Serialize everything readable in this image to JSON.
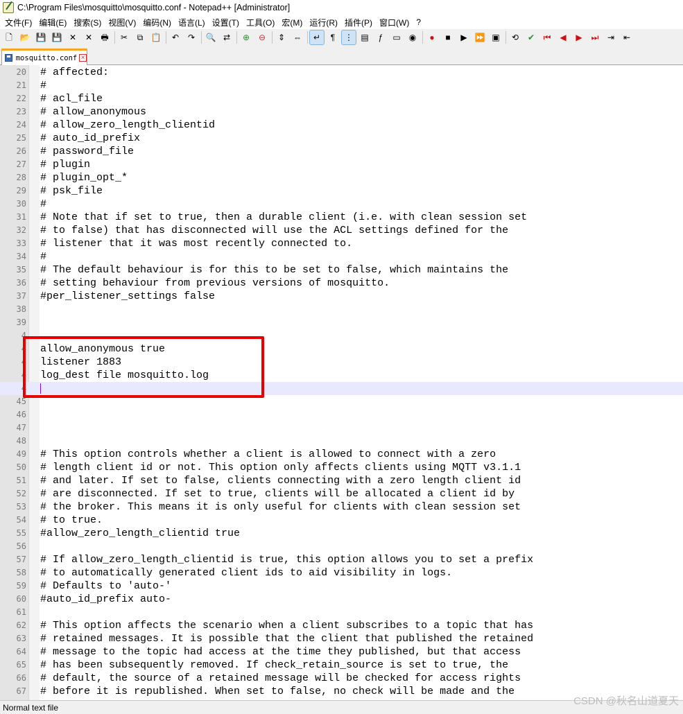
{
  "window": {
    "title": "C:\\Program Files\\mosquitto\\mosquitto.conf - Notepad++ [Administrator]"
  },
  "menu": [
    "文件(F)",
    "编辑(E)",
    "搜索(S)",
    "视图(V)",
    "编码(N)",
    "语言(L)",
    "设置(T)",
    "工具(O)",
    "宏(M)",
    "运行(R)",
    "插件(P)",
    "窗口(W)",
    "?"
  ],
  "toolbar": {
    "icons": [
      "new-icon",
      "open-icon",
      "save-icon",
      "save-all-icon",
      "close-icon",
      "close-all-icon",
      "print-icon",
      "cut-icon",
      "copy-icon",
      "paste-icon",
      "undo-icon",
      "redo-icon",
      "find-icon",
      "replace-icon",
      "zoom-in-icon",
      "zoom-out-icon",
      "sync-vertical-icon",
      "sync-horizontal-icon",
      "word-wrap-icon",
      "show-all-chars-icon",
      "indent-guide-icon",
      "doc-map-icon",
      "function-list-icon",
      "folder-workspace-icon",
      "monitor-icon",
      "record-macro-icon",
      "stop-macro-icon",
      "play-macro-icon",
      "run-macro-multiple-icon",
      "save-macro-icon",
      "plugin-a-icon",
      "plugin-b-icon",
      "nav-first-icon",
      "nav-prev-icon",
      "nav-next-icon",
      "nav-last-icon",
      "plugin-c-icon",
      "plugin-d-icon"
    ],
    "active": [
      "word-wrap-icon",
      "indent-guide-icon"
    ]
  },
  "tab": {
    "label": "mosquitto.conf"
  },
  "editor": {
    "current_line": 44,
    "lines": [
      {
        "n": "20",
        "text": "# affected:"
      },
      {
        "n": "21",
        "text": "#"
      },
      {
        "n": "22",
        "text": "# acl_file"
      },
      {
        "n": "23",
        "text": "# allow_anonymous"
      },
      {
        "n": "24",
        "text": "# allow_zero_length_clientid"
      },
      {
        "n": "25",
        "text": "# auto_id_prefix"
      },
      {
        "n": "26",
        "text": "# password_file"
      },
      {
        "n": "27",
        "text": "# plugin"
      },
      {
        "n": "28",
        "text": "# plugin_opt_*"
      },
      {
        "n": "29",
        "text": "# psk_file"
      },
      {
        "n": "30",
        "text": "#"
      },
      {
        "n": "31",
        "text": "# Note that if set to true, then a durable client (i.e. with clean session set"
      },
      {
        "n": "32",
        "text": "# to false) that has disconnected will use the ACL settings defined for the"
      },
      {
        "n": "33",
        "text": "# listener that it was most recently connected to."
      },
      {
        "n": "34",
        "text": "#"
      },
      {
        "n": "35",
        "text": "# The default behaviour is for this to be set to false, which maintains the"
      },
      {
        "n": "36",
        "text": "# setting behaviour from previous versions of mosquitto."
      },
      {
        "n": "37",
        "text": "#per_listener_settings false"
      },
      {
        "n": "38",
        "text": ""
      },
      {
        "n": "39",
        "text": ""
      },
      {
        "n": "4",
        "text": ""
      },
      {
        "n": "4",
        "text": "allow_anonymous true"
      },
      {
        "n": "4",
        "text": "listener 1883"
      },
      {
        "n": "4",
        "text": "log_dest file mosquitto.log"
      },
      {
        "n": "4",
        "text": ""
      },
      {
        "n": "45",
        "text": ""
      },
      {
        "n": "46",
        "text": ""
      },
      {
        "n": "47",
        "text": ""
      },
      {
        "n": "48",
        "text": ""
      },
      {
        "n": "49",
        "text": "# This option controls whether a client is allowed to connect with a zero"
      },
      {
        "n": "50",
        "text": "# length client id or not. This option only affects clients using MQTT v3.1.1"
      },
      {
        "n": "51",
        "text": "# and later. If set to false, clients connecting with a zero length client id"
      },
      {
        "n": "52",
        "text": "# are disconnected. If set to true, clients will be allocated a client id by"
      },
      {
        "n": "53",
        "text": "# the broker. This means it is only useful for clients with clean session set"
      },
      {
        "n": "54",
        "text": "# to true."
      },
      {
        "n": "55",
        "text": "#allow_zero_length_clientid true"
      },
      {
        "n": "56",
        "text": ""
      },
      {
        "n": "57",
        "text": "# If allow_zero_length_clientid is true, this option allows you to set a prefix"
      },
      {
        "n": "58",
        "text": "# to automatically generated client ids to aid visibility in logs."
      },
      {
        "n": "59",
        "text": "# Defaults to 'auto-'"
      },
      {
        "n": "60",
        "text": "#auto_id_prefix auto-"
      },
      {
        "n": "61",
        "text": ""
      },
      {
        "n": "62",
        "text": "# This option affects the scenario when a client subscribes to a topic that has"
      },
      {
        "n": "63",
        "text": "# retained messages. It is possible that the client that published the retained"
      },
      {
        "n": "64",
        "text": "# message to the topic had access at the time they published, but that access"
      },
      {
        "n": "65",
        "text": "# has been subsequently removed. If check_retain_source is set to true, the"
      },
      {
        "n": "66",
        "text": "# default, the source of a retained message will be checked for access rights"
      },
      {
        "n": "67",
        "text": "# before it is republished. When set to false, no check will be made and the"
      }
    ]
  },
  "statusbar": {
    "doc_type": "Normal text file"
  },
  "watermark": "CSDN @秋名山道夏天",
  "colors": {
    "highlight_box": "#e60000",
    "current_line": "#e8e8ff",
    "caret": "#8000ff",
    "tab_accent": "#f5a623"
  }
}
